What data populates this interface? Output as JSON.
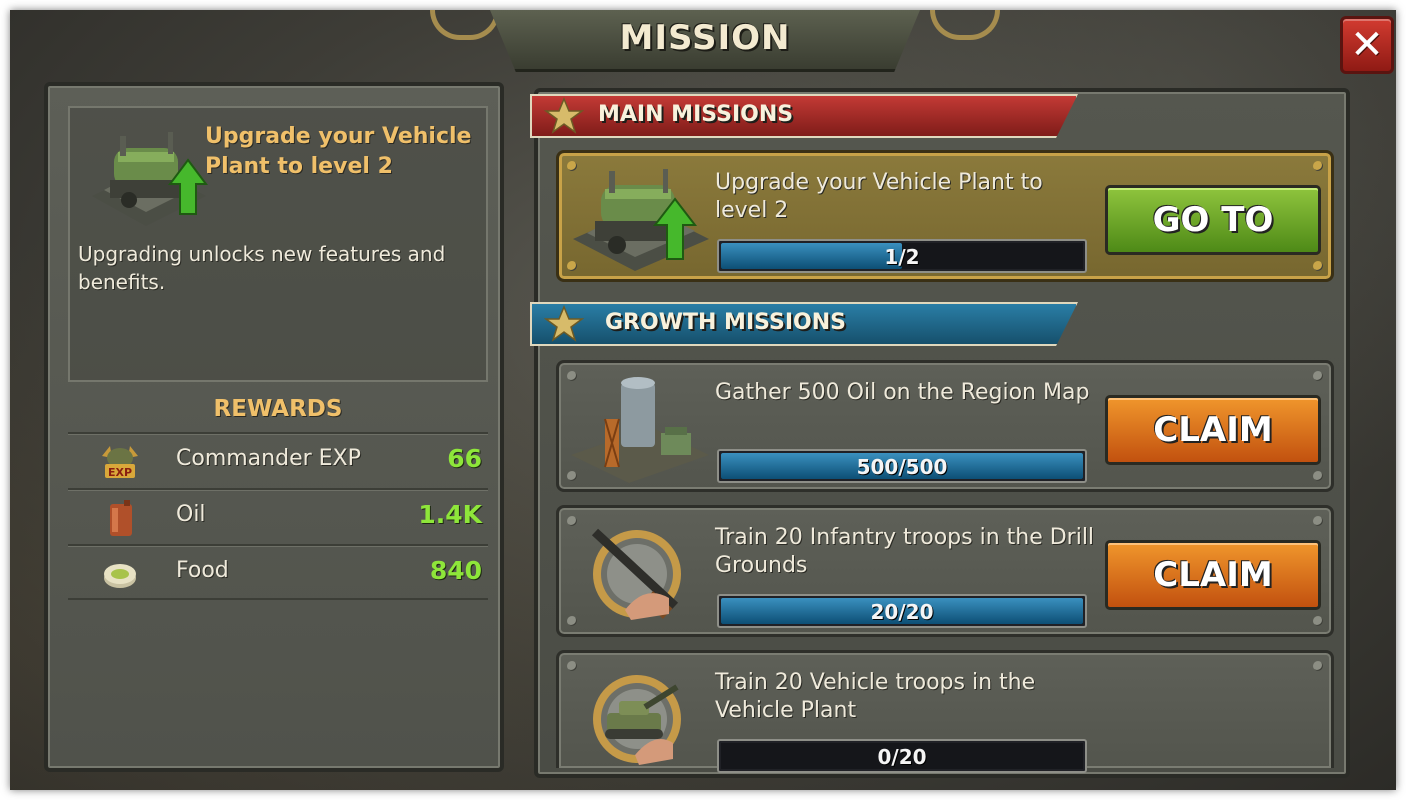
{
  "header": {
    "title": "MISSION"
  },
  "close": {
    "label": "✕"
  },
  "detail": {
    "title": "Upgrade your Vehicle Plant to level 2",
    "description": "Upgrading unlocks new features and benefits."
  },
  "rewards": {
    "heading": "REWARDS",
    "items": [
      {
        "icon": "commander-exp-icon",
        "icon_text": "EXP",
        "name": "Commander EXP",
        "value": "66"
      },
      {
        "icon": "oil-canister-icon",
        "name": "Oil",
        "value": "1.4K"
      },
      {
        "icon": "food-can-icon",
        "name": "Food",
        "value": "840"
      }
    ]
  },
  "sections": {
    "main": {
      "label": "MAIN MISSIONS",
      "color": "#c33a35"
    },
    "growth": {
      "label": "GROWTH MISSIONS",
      "color": "#2a7ea6"
    }
  },
  "missions": [
    {
      "icon": "vehicle-plant-icon",
      "text": "Upgrade your Vehicle Plant to level 2",
      "progress_text": "1/2",
      "progress": 0.5,
      "button": "GO TO"
    },
    {
      "icon": "oil-rig-icon",
      "text": "Gather 500 Oil on the Region Map",
      "progress_text": "500/500",
      "progress": 1.0,
      "button": "CLAIM"
    },
    {
      "icon": "infantry-icon",
      "text": "Train 20 Infantry troops in the Drill Grounds",
      "progress_text": "20/20",
      "progress": 1.0,
      "button": "CLAIM"
    },
    {
      "icon": "tank-icon",
      "text": "Train 20 Vehicle troops in the Vehicle Plant",
      "progress_text": "0/20",
      "progress": 0.0,
      "button": ""
    }
  ],
  "colors": {
    "accent_gold": "#f0c06a",
    "reward_green": "#8ee63a",
    "go_green": "#6aa92a",
    "claim_orange": "#e07a1d"
  }
}
